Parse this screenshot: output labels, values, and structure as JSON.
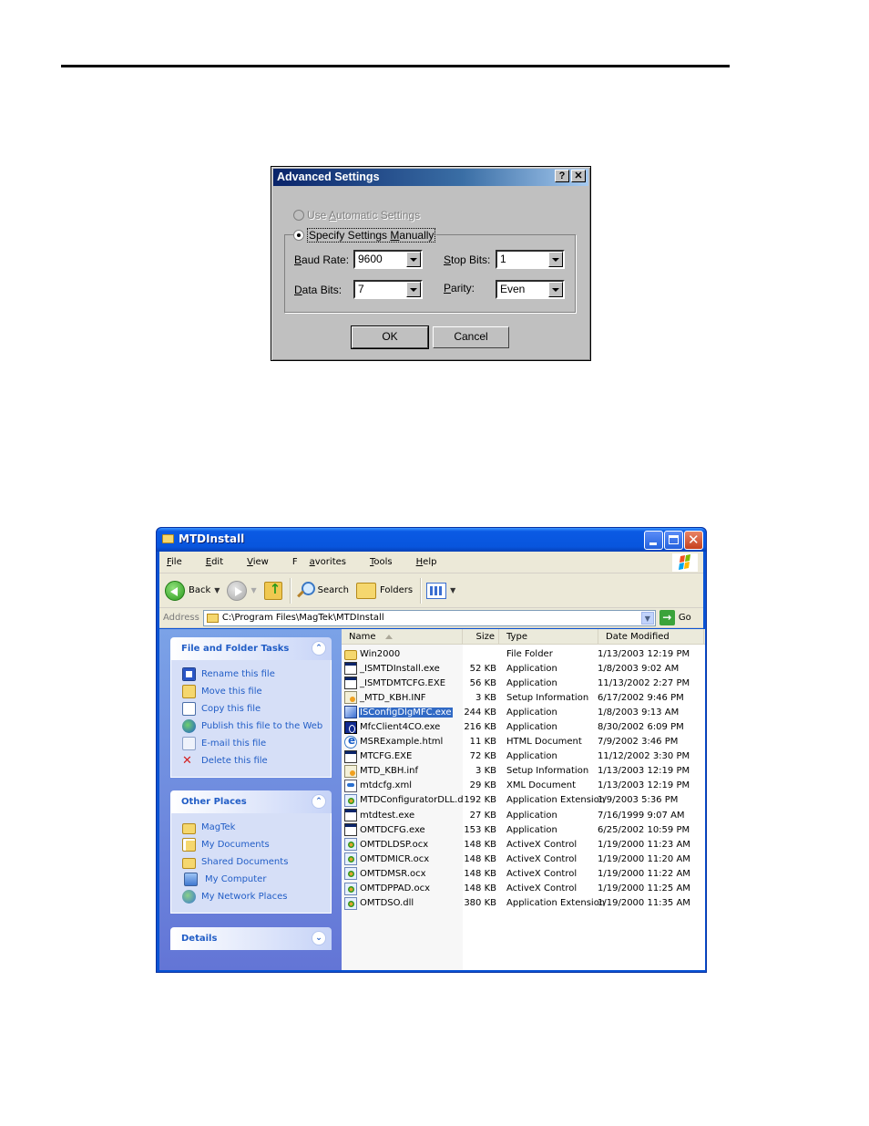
{
  "dialog": {
    "title": "Advanced Settings",
    "help_button": "?",
    "close_button": "✕",
    "radio_auto": {
      "pre": "Use ",
      "accel": "A",
      "post": "utomatic Settings",
      "checked": false,
      "enabled": false
    },
    "radio_manual": {
      "pre": "Specify Settings ",
      "accel": "M",
      "post": "anually",
      "checked": true,
      "enabled": true
    },
    "fields": {
      "baud_rate": {
        "accel": "B",
        "label_rest": "aud Rate:",
        "value": "9600"
      },
      "data_bits": {
        "accel": "D",
        "label_rest": "ata Bits:",
        "value": "7"
      },
      "stop_bits": {
        "accel": "S",
        "label_rest": "top Bits:",
        "value": "1"
      },
      "parity": {
        "accel": "P",
        "label_rest": "arity:",
        "value": "Even"
      }
    },
    "ok_label": "OK",
    "cancel_label": "Cancel"
  },
  "explorer": {
    "title": "MTDInstall",
    "menu": [
      {
        "accel": "F",
        "rest": "ile"
      },
      {
        "accel": "E",
        "rest": "dit"
      },
      {
        "accel": "V",
        "rest": "iew"
      },
      {
        "pre": "F",
        "accel": "a",
        "rest": "vorites"
      },
      {
        "accel": "T",
        "rest": "ools"
      },
      {
        "accel": "H",
        "rest": "elp"
      }
    ],
    "toolbar": {
      "back": "Back",
      "search": "Search",
      "folders": "Folders"
    },
    "address": {
      "label": "Address",
      "value": "C:\\Program Files\\MagTek\\MTDInstall",
      "go": "Go"
    },
    "panels": {
      "file_tasks": {
        "title": "File and Folder Tasks",
        "items": [
          {
            "label": "Rename this file",
            "icon": "rename-icon"
          },
          {
            "label": "Move this file",
            "icon": "move-icon"
          },
          {
            "label": "Copy this file",
            "icon": "copy-icon"
          },
          {
            "label": "Publish this file to the Web",
            "icon": "globe-icon"
          },
          {
            "label": "E-mail this file",
            "icon": "email-icon"
          },
          {
            "label": "Delete this file",
            "icon": "delete-icon"
          }
        ]
      },
      "other_places": {
        "title": "Other Places",
        "items": [
          {
            "label": "MagTek",
            "icon": "folder-icon"
          },
          {
            "label": "My Documents",
            "icon": "my-documents-icon"
          },
          {
            "label": "Shared Documents",
            "icon": "folder-icon"
          },
          {
            "label": "My Computer",
            "icon": "computer-icon"
          },
          {
            "label": "My Network Places",
            "icon": "network-icon"
          }
        ]
      },
      "details": {
        "title": "Details"
      }
    },
    "columns": {
      "name": "Name",
      "size": "Size",
      "type": "Type",
      "date": "Date Modified"
    },
    "files": [
      {
        "name": "Win2000",
        "size": "",
        "type": "File Folder",
        "date": "1/13/2003 12:19 PM",
        "icon": "folder"
      },
      {
        "name": "_ISMTDInstall.exe",
        "size": "52 KB",
        "type": "Application",
        "date": "1/8/2003 9:02 AM",
        "icon": "app"
      },
      {
        "name": "_ISMTDMTCFG.EXE",
        "size": "56 KB",
        "type": "Application",
        "date": "11/13/2002 2:27 PM",
        "icon": "app"
      },
      {
        "name": "_MTD_KBH.INF",
        "size": "3 KB",
        "type": "Setup Information",
        "date": "6/17/2002 9:46 PM",
        "icon": "inf"
      },
      {
        "name": "ISConfigDlgMFC.exe",
        "size": "244 KB",
        "type": "Application",
        "date": "1/8/2003 9:13 AM",
        "icon": "isconf",
        "selected": true
      },
      {
        "name": "MfcClient4CO.exe",
        "size": "216 KB",
        "type": "Application",
        "date": "8/30/2002 6:09 PM",
        "icon": "mfc"
      },
      {
        "name": "MSRExample.html",
        "size": "11 KB",
        "type": "HTML Document",
        "date": "7/9/2002 3:46 PM",
        "icon": "html"
      },
      {
        "name": "MTCFG.EXE",
        "size": "72 KB",
        "type": "Application",
        "date": "11/12/2002 3:30 PM",
        "icon": "app"
      },
      {
        "name": "MTD_KBH.inf",
        "size": "3 KB",
        "type": "Setup Information",
        "date": "1/13/2003 12:19 PM",
        "icon": "inf"
      },
      {
        "name": "mtdcfg.xml",
        "size": "29 KB",
        "type": "XML Document",
        "date": "1/13/2003 12:19 PM",
        "icon": "xml"
      },
      {
        "name": "MTDConfiguratorDLL.dll",
        "size": "192 KB",
        "type": "Application Extension",
        "date": "1/9/2003 5:36 PM",
        "icon": "dll"
      },
      {
        "name": "mtdtest.exe",
        "size": "27 KB",
        "type": "Application",
        "date": "7/16/1999 9:07 AM",
        "icon": "app"
      },
      {
        "name": "OMTDCFG.exe",
        "size": "153 KB",
        "type": "Application",
        "date": "6/25/2002 10:59 PM",
        "icon": "app"
      },
      {
        "name": "OMTDLDSP.ocx",
        "size": "148 KB",
        "type": "ActiveX Control",
        "date": "1/19/2000 11:23 AM",
        "icon": "dll"
      },
      {
        "name": "OMTDMICR.ocx",
        "size": "148 KB",
        "type": "ActiveX Control",
        "date": "1/19/2000 11:20 AM",
        "icon": "dll"
      },
      {
        "name": "OMTDMSR.ocx",
        "size": "148 KB",
        "type": "ActiveX Control",
        "date": "1/19/2000 11:22 AM",
        "icon": "dll"
      },
      {
        "name": "OMTDPPAD.ocx",
        "size": "148 KB",
        "type": "ActiveX Control",
        "date": "1/19/2000 11:25 AM",
        "icon": "dll"
      },
      {
        "name": "OMTDSO.dll",
        "size": "380 KB",
        "type": "Application Extension",
        "date": "1/19/2000 11:35 AM",
        "icon": "dll"
      }
    ]
  }
}
